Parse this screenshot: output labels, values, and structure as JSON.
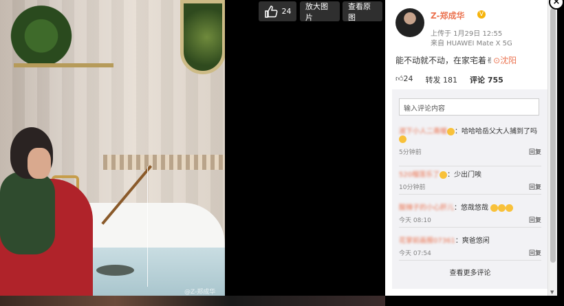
{
  "toolbar": {
    "like_count": "24",
    "zoom_label": "放大图片",
    "original_label": "查看原图"
  },
  "post": {
    "username": "Z-郑成华",
    "verified_icon": "v-verified-icon",
    "upload_time": "上传于 1月29日 12:55",
    "source": "来自 HUAWEI Mate X 5G",
    "text": "能不动就不动，在家宅着",
    "location": "沈阳"
  },
  "actions": {
    "like": "24",
    "repost": "转发 181",
    "comment": "评论 755"
  },
  "comment_input": {
    "placeholder": "输入评论内容"
  },
  "comments": [
    {
      "user": "淑下小人二斋暖",
      "text": "：哈哈哈岳父大人捕到了吗",
      "time": "5分钟前",
      "reply": "回复"
    },
    {
      "user": "520榴莲乐了",
      "text": "：少出门唉",
      "time": "10分钟前",
      "reply": "回复"
    },
    {
      "user": "酸辣子的小心肝儿",
      "text": "：悠哉悠哉",
      "time": "今天 08:10",
      "reply": "回复"
    },
    {
      "user": "花掌前画报07361",
      "text": "：爽爸悠闲",
      "time": "今天 07:54",
      "reply": "回复"
    }
  ],
  "more_comments": "查看更多评论",
  "watermark": "@Z-郑成华",
  "close": "×"
}
